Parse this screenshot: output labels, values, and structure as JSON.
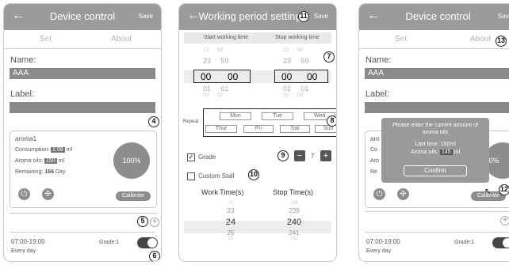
{
  "panel1": {
    "back": "←",
    "title": "Device control",
    "save": "Save",
    "tab_set": "Set",
    "tab_about": "About",
    "name_label": "Name:",
    "name_value": "AAA",
    "label_label": "Label:",
    "label_value": "",
    "aroma_name": "aroma1",
    "consumption_label": "Consumption:",
    "consumption_value": "1.58",
    "consumption_unit": "ml",
    "aroma_oils_label": "Aroma oils:",
    "aroma_oils_value": "150",
    "aroma_oils_unit": "ml",
    "remaining_label": "Remaining:",
    "remaining_value": "166",
    "remaining_unit": "Day",
    "level": "100%",
    "calibrate": "Calibrate",
    "schedule_time": "07:00-19:00",
    "schedule_days": "Every day",
    "grade": "Grade:1",
    "badge4": "4",
    "badge5": "5",
    "badge6": "6"
  },
  "panel2": {
    "back": "←",
    "title": "Working period setting",
    "save": "Save",
    "badge11": "11",
    "start_header": "Start working time",
    "stop_header": "Stop working time",
    "start_above2": "22     58",
    "start_above1": "23     59",
    "start_h": "00",
    "start_m": "00",
    "start_below1": "01     01",
    "start_below2": "02     02",
    "stop_above2": "22     58",
    "stop_above1": "23     59",
    "stop_h": "00",
    "stop_m": "00",
    "stop_below1": "01     01",
    "stop_below2": "02     02",
    "badge7": "7",
    "repeat": "Repeat",
    "days": [
      "Mon",
      "Tue",
      "Wed",
      "Thur",
      "Fri",
      "Sat",
      "Sun"
    ],
    "badge8": "8",
    "grade_label": "Grade",
    "badge9": "9",
    "grade_value": "7",
    "minus": "−",
    "plus": "+",
    "custom_stall": "Custom Stall",
    "badge10": "10",
    "work_time": "Work Time(s)",
    "stop_time": "Stop Time(s)",
    "work_values": [
      "22",
      "23",
      "24",
      "25",
      "26"
    ],
    "stop_values": [
      "238",
      "239",
      "240",
      "241",
      "242"
    ]
  },
  "panel3": {
    "back": "←",
    "title": "Device control",
    "save": "Save",
    "tab_set": "Set",
    "tab_about": "About",
    "badge13": "13",
    "name_label": "Name:",
    "name_value": "AAA",
    "label_label": "Label:",
    "card_line1": "aro",
    "card_line2": "Co",
    "card_line3": "Aro",
    "card_line4": "Re",
    "level_partial": "0%",
    "dialog_text": "Please enter the current amount of aroma oils",
    "dialog_last": "Last time: 150ml",
    "dialog_oils_label": "Aroma oils:",
    "dialog_oils_value": "145",
    "dialog_oils_unit": "ml",
    "confirm": "Confirm",
    "badge12": "12",
    "calibrate": "Calibrate",
    "schedule_time": "07:00-19:00",
    "schedule_days": "Every day",
    "grade": "Grade:1"
  }
}
